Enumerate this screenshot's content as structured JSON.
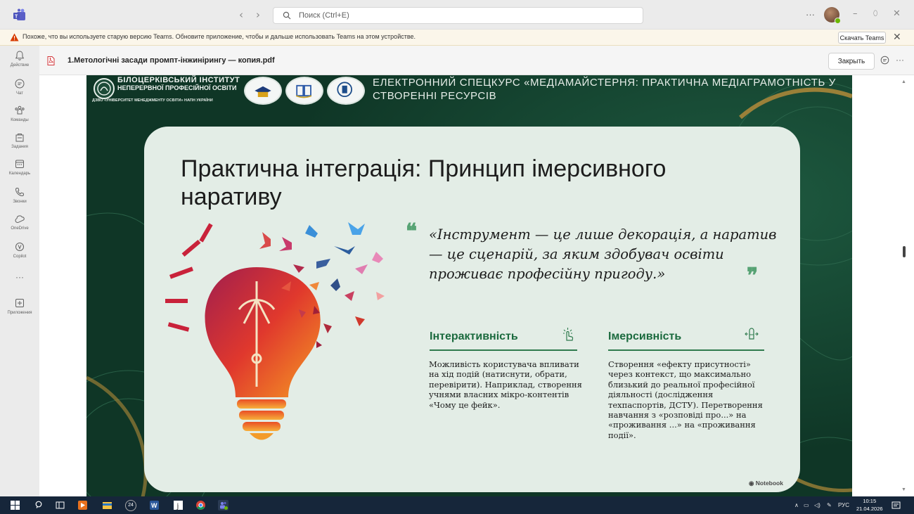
{
  "window": {
    "search_placeholder": "Поиск (Ctrl+E)",
    "nav_back": "‹",
    "nav_forward": "›",
    "more": "···",
    "minimize": "–",
    "restore": "⬯",
    "close": "✕"
  },
  "notification": {
    "text": "Похоже, что вы используете старую версию Teams. Обновите приложение, чтобы и дальше использовать Teams на этом устройстве.",
    "button": "Скачать Teams",
    "close": "✕"
  },
  "sidebar": {
    "items": [
      {
        "label": "Действие",
        "icon": "bell-icon"
      },
      {
        "label": "Чат",
        "icon": "chat-icon"
      },
      {
        "label": "Команды",
        "icon": "teams-icon"
      },
      {
        "label": "Задания",
        "icon": "assignments-icon"
      },
      {
        "label": "Календарь",
        "icon": "calendar-icon"
      },
      {
        "label": "Звонки",
        "icon": "phone-icon"
      },
      {
        "label": "OneDrive",
        "icon": "onedrive-icon"
      },
      {
        "label": "Copilot",
        "icon": "copilot-icon"
      },
      {
        "label": "···",
        "icon": "more-icon"
      },
      {
        "label": "Приложения",
        "icon": "apps-icon"
      }
    ]
  },
  "document": {
    "title": "1.Метологічні засади промпт-інжинірингу — копия.pdf",
    "close_button": "Закрыть",
    "more": "···"
  },
  "slide": {
    "institute_name": "БІЛОЦЕРКІВСЬКИЙ ІНСТИТУТ",
    "institute_sub": "НЕПЕРЕРВНОЇ ПРОФЕСІЙНОЇ ОСВІТИ",
    "institute_parent": "ДЗВО «УНІВЕРСИТЕТ МЕНЕДЖМЕНТУ ОСВІТИ» НАПН УКРАЇНИ",
    "course_title": "ЕЛЕКТРОННИЙ СПЕЦКУРС «МЕДІАМАЙСТЕРНЯ: ПРАКТИЧНА МЕДІАГРАМОТНІСТЬ У СТВОРЕННІ РЕСУРСІВ",
    "heading": "Практична інтеграція: Принцип імерсивного наративу",
    "quote_open": "❝",
    "quote": "«Інструмент — це лише декорація, а наратив — це сценарій, за яким здобувач освіти проживає професійну пригоду.»",
    "quote_close": "❞",
    "columns": [
      {
        "title": "Інтерактивність",
        "icon": "tap-hand-icon",
        "body": "Можливість користувача впливати на хід подій (натиснути, обрати, перевірити). Наприклад, створення учнями власних мікро-контентів «Чому це фейк»."
      },
      {
        "title": "Імерсивність",
        "icon": "immersion-icon",
        "body": "Створення «ефекту присутності» через контекст, що максимально близький до реальної професійної діяльності (дослідження техпаспортів, ДСТУ). Перетворення навчання з «розповіді про...» на «проживання ...» на «проживання події»."
      }
    ],
    "watermark": "Notebook"
  },
  "taskbar": {
    "chrome_badge": "24",
    "tray_lang": "РУС",
    "time": "10:15",
    "date": "21.04.2026"
  },
  "colors": {
    "slide_background": "#113c2b",
    "card": "#e3ede6",
    "accent_green": "#1b6a3e",
    "warning": "#d83b01",
    "taskbar": "#16263a"
  }
}
